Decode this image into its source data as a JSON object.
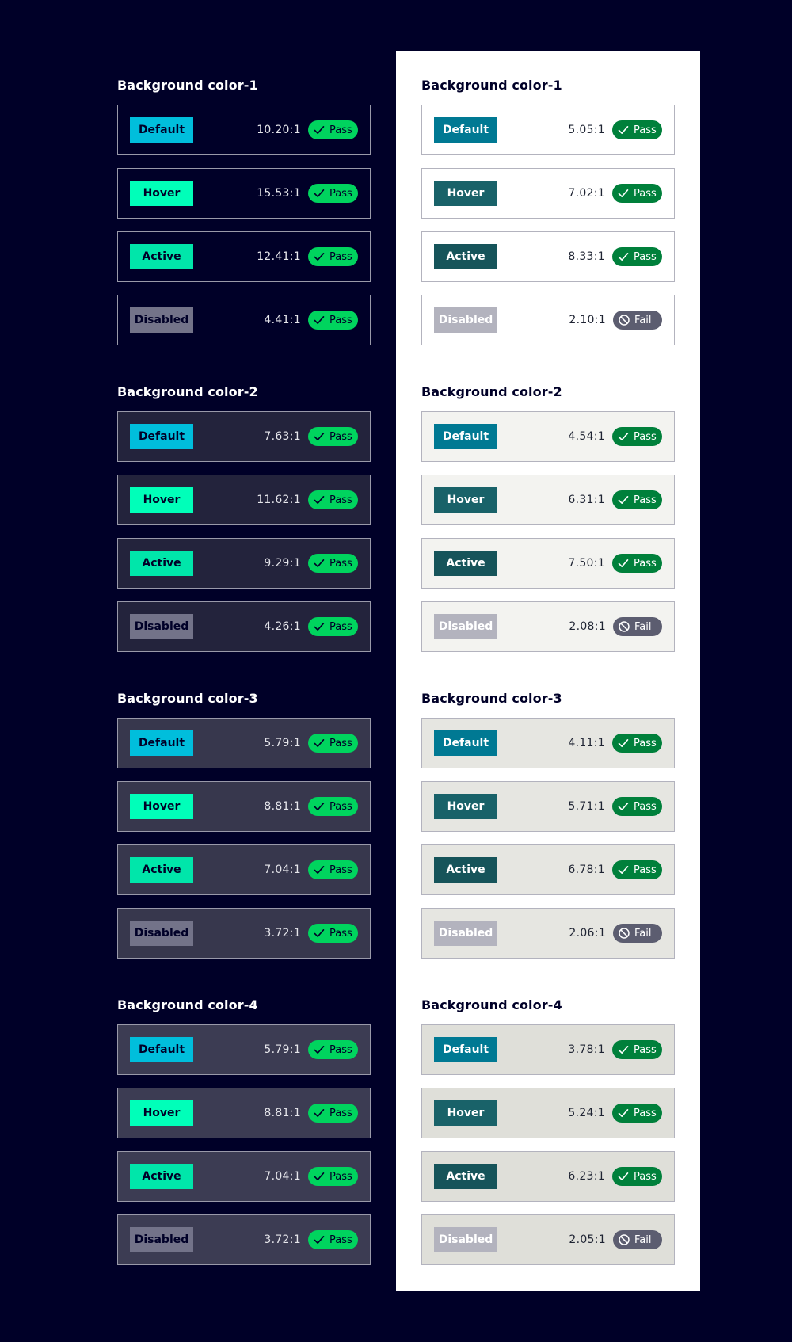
{
  "columns": [
    {
      "theme": "dark",
      "button_colors": {
        "Default": {
          "bg": "#00bedc",
          "fg": "#000028"
        },
        "Hover": {
          "bg": "#00ffb9",
          "fg": "#000028"
        },
        "Active": {
          "bg": "#00e6aa",
          "fg": "#000028"
        },
        "Disabled": {
          "bg": "#737389",
          "fg": "#000028"
        }
      },
      "groups": [
        {
          "title": "Background color-1",
          "bg": "#000028",
          "border": "#9999a9",
          "rows": [
            {
              "label": "Default",
              "ratio": "10.20:1",
              "status": "Pass",
              "icon": "check-icon"
            },
            {
              "label": "Hover",
              "ratio": "15.53:1",
              "status": "Pass",
              "icon": "check-icon"
            },
            {
              "label": "Active",
              "ratio": "12.41:1",
              "status": "Pass",
              "icon": "check-icon"
            },
            {
              "label": "Disabled",
              "ratio": "4.41:1",
              "status": "Pass",
              "icon": "check-icon"
            }
          ]
        },
        {
          "title": "Background color-2",
          "bg": "#23233c",
          "border": "#9999a9",
          "rows": [
            {
              "label": "Default",
              "ratio": "7.63:1",
              "status": "Pass",
              "icon": "check-icon"
            },
            {
              "label": "Hover",
              "ratio": "11.62:1",
              "status": "Pass",
              "icon": "check-icon"
            },
            {
              "label": "Active",
              "ratio": "9.29:1",
              "status": "Pass",
              "icon": "check-icon"
            },
            {
              "label": "Disabled",
              "ratio": "4.26:1",
              "status": "Pass",
              "icon": "check-icon"
            }
          ]
        },
        {
          "title": "Background color-3",
          "bg": "#37374d",
          "border": "#9999a9",
          "rows": [
            {
              "label": "Default",
              "ratio": "5.79:1",
              "status": "Pass",
              "icon": "check-icon"
            },
            {
              "label": "Hover",
              "ratio": "8.81:1",
              "status": "Pass",
              "icon": "check-icon"
            },
            {
              "label": "Active",
              "ratio": "7.04:1",
              "status": "Pass",
              "icon": "check-icon"
            },
            {
              "label": "Disabled",
              "ratio": "3.72:1",
              "status": "Pass",
              "icon": "check-icon"
            }
          ]
        },
        {
          "title": "Background color-4",
          "bg": "#3c3c53",
          "border": "#9999a9",
          "rows": [
            {
              "label": "Default",
              "ratio": "5.79:1",
              "status": "Pass",
              "icon": "check-icon"
            },
            {
              "label": "Hover",
              "ratio": "8.81:1",
              "status": "Pass",
              "icon": "check-icon"
            },
            {
              "label": "Active",
              "ratio": "7.04:1",
              "status": "Pass",
              "icon": "check-icon"
            },
            {
              "label": "Disabled",
              "ratio": "3.72:1",
              "status": "Pass",
              "icon": "check-icon"
            }
          ]
        }
      ]
    },
    {
      "theme": "light",
      "button_colors": {
        "Default": {
          "bg": "#007993",
          "fg": "#ffffff"
        },
        "Hover": {
          "bg": "#196269",
          "fg": "#ffffff"
        },
        "Active": {
          "bg": "#16545a",
          "fg": "#ffffff"
        },
        "Disabled": {
          "bg": "#b3b3be",
          "fg": "#ffffff"
        }
      },
      "groups": [
        {
          "title": "Background color-1",
          "bg": "#ffffff",
          "border": "#b3b3be",
          "rows": [
            {
              "label": "Default",
              "ratio": "5.05:1",
              "status": "Pass",
              "icon": "check-icon"
            },
            {
              "label": "Hover",
              "ratio": "7.02:1",
              "status": "Pass",
              "icon": "check-icon"
            },
            {
              "label": "Active",
              "ratio": "8.33:1",
              "status": "Pass",
              "icon": "check-icon"
            },
            {
              "label": "Disabled",
              "ratio": "2.10:1",
              "status": "Fail",
              "icon": "block-icon"
            }
          ]
        },
        {
          "title": "Background color-2",
          "bg": "#f3f3f0",
          "border": "#b3b3be",
          "rows": [
            {
              "label": "Default",
              "ratio": "4.54:1",
              "status": "Pass",
              "icon": "check-icon"
            },
            {
              "label": "Hover",
              "ratio": "6.31:1",
              "status": "Pass",
              "icon": "check-icon"
            },
            {
              "label": "Active",
              "ratio": "7.50:1",
              "status": "Pass",
              "icon": "check-icon"
            },
            {
              "label": "Disabled",
              "ratio": "2.08:1",
              "status": "Fail",
              "icon": "block-icon"
            }
          ]
        },
        {
          "title": "Background color-3",
          "bg": "#e6e6e1",
          "border": "#b3b3be",
          "rows": [
            {
              "label": "Default",
              "ratio": "4.11:1",
              "status": "Pass",
              "icon": "check-icon"
            },
            {
              "label": "Hover",
              "ratio": "5.71:1",
              "status": "Pass",
              "icon": "check-icon"
            },
            {
              "label": "Active",
              "ratio": "6.78:1",
              "status": "Pass",
              "icon": "check-icon"
            },
            {
              "label": "Disabled",
              "ratio": "2.06:1",
              "status": "Fail",
              "icon": "block-icon"
            }
          ]
        },
        {
          "title": "Background color-4",
          "bg": "#dfdfd9",
          "border": "#b3b3be",
          "rows": [
            {
              "label": "Default",
              "ratio": "3.78:1",
              "status": "Pass",
              "icon": "check-icon"
            },
            {
              "label": "Hover",
              "ratio": "5.24:1",
              "status": "Pass",
              "icon": "check-icon"
            },
            {
              "label": "Active",
              "ratio": "6.23:1",
              "status": "Pass",
              "icon": "check-icon"
            },
            {
              "label": "Disabled",
              "ratio": "2.05:1",
              "status": "Fail",
              "icon": "block-icon"
            }
          ]
        }
      ]
    }
  ]
}
